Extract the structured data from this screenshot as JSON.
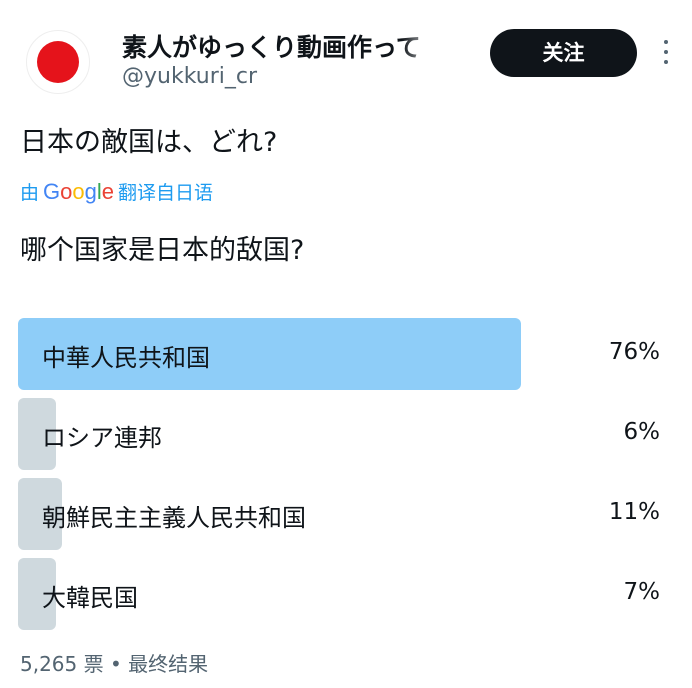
{
  "author": {
    "display_name": "素人がゆっくり動画作って",
    "handle": "@yukkuri_cr",
    "follow_label": "关注"
  },
  "tweet": {
    "text": "日本の敵国は、どれ?",
    "translate_prefix": "由",
    "translate_brand": [
      "G",
      "o",
      "o",
      "g",
      "l",
      "e"
    ],
    "translate_suffix": "翻译自日语",
    "translated_text": "哪个国家是日本的敌国?"
  },
  "poll": {
    "options": [
      {
        "label": "中華人民共和国",
        "percent": "76%",
        "value": 76,
        "winner": true
      },
      {
        "label": "ロシア連邦",
        "percent": "6%",
        "value": 6,
        "winner": false
      },
      {
        "label": "朝鮮民主主義人民共和国",
        "percent": "11%",
        "value": 11,
        "winner": false
      },
      {
        "label": "大韓民国",
        "percent": "7%",
        "value": 7,
        "winner": false
      }
    ],
    "votes": "5,265 票",
    "separator": "•",
    "status": "最终结果"
  },
  "colors": {
    "winner_bar": "#8ecdf8",
    "other_bar": "#cfd9de",
    "link": "#1d9bf0",
    "avatar_sun": "#e5131b"
  }
}
